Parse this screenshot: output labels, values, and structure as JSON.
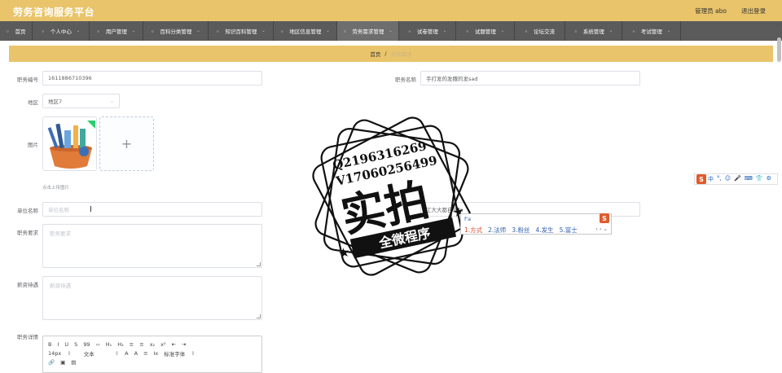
{
  "app": {
    "title": "劳务咨询服务平台"
  },
  "user": {
    "name": "管理员 abo",
    "logout": "退出登录"
  },
  "nav": [
    {
      "label": "首页",
      "icon": "home-icon",
      "has_menu": false,
      "active": false
    },
    {
      "label": "个人中心",
      "icon": "person-icon",
      "has_menu": true,
      "active": false
    },
    {
      "label": "用户管理",
      "icon": "user-icon",
      "has_menu": true,
      "active": false
    },
    {
      "label": "百科分类管理",
      "icon": "category-icon",
      "has_menu": true,
      "active": false
    },
    {
      "label": "知识百科管理",
      "icon": "book-icon",
      "has_menu": true,
      "active": false
    },
    {
      "label": "地区信息管理",
      "icon": "map-icon",
      "has_menu": true,
      "active": false
    },
    {
      "label": "劳务需求管理",
      "icon": "list-icon",
      "has_menu": true,
      "active": true
    },
    {
      "label": "试卷管理",
      "icon": "paper-icon",
      "has_menu": true,
      "active": false
    },
    {
      "label": "试题管理",
      "icon": "question-icon",
      "has_menu": true,
      "active": false
    },
    {
      "label": "论坛交流",
      "icon": "forum-icon",
      "has_menu": false,
      "active": false
    },
    {
      "label": "系统管理",
      "icon": "gear-icon",
      "has_menu": true,
      "active": false
    },
    {
      "label": "考试管理",
      "icon": "exam-icon",
      "has_menu": true,
      "active": false
    }
  ],
  "breadcrumb": {
    "home": "首页",
    "sep": "/",
    "current": "劳务需求"
  },
  "form": {
    "job_no_label": "职务编号",
    "job_no_value": "1611886710396",
    "job_name_label": "职务名称",
    "job_name_value": "手打发的发撒的发sad",
    "region_label": "地区",
    "region_value": "地区7",
    "image_label": "图片",
    "upload_hint": "点击上传图片",
    "unit_label": "单位名称",
    "unit_placeholder": "单位名称",
    "right_field_value": "工大大都自治fa",
    "req_label": "职务要求",
    "req_placeholder": "职务要求",
    "salary_label": "薪资待遇",
    "salary_placeholder": "薪资待遇",
    "detail_label": "职务详情"
  },
  "editor": {
    "row1": [
      "B",
      "I",
      "U",
      "S",
      "99",
      "‹›",
      "H₁",
      "H₂",
      "≡",
      "≡",
      "x₂",
      "x²",
      "⇤",
      "⇥"
    ],
    "font_size": "14px",
    "block_type": "文本",
    "font_family": "标准字体",
    "row2_tail": [
      "A",
      "A",
      "≡",
      "Ix"
    ]
  },
  "watermark": {
    "line1": "Q2196316269",
    "line2": "V17060256499",
    "big": "实拍",
    "banner": "全微程序"
  },
  "ime": {
    "toolbar": [
      "中",
      "°,",
      "☺",
      "🎤",
      "⌨",
      "👕",
      "⚙"
    ],
    "composition": "f'a",
    "candidates": [
      "1.方式",
      "2.法师",
      "3.粉丝",
      "4.发生",
      "5.富士"
    ],
    "nav": "‹ › ⌄",
    "logo": "S"
  },
  "colors": {
    "accent": "#e9c46a",
    "nav_bg": "#5b5b5b"
  }
}
